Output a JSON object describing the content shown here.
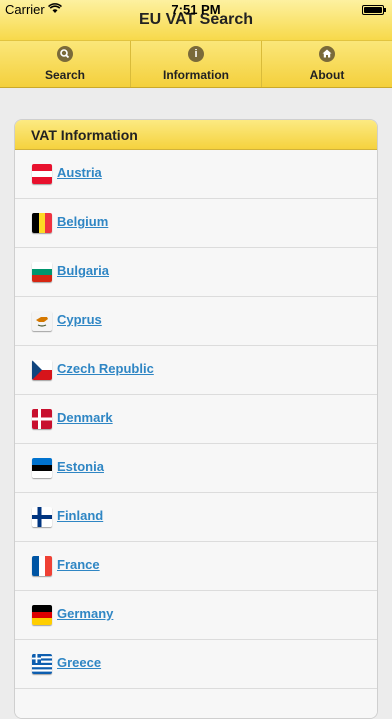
{
  "statusbar": {
    "carrier": "Carrier",
    "time": "7:51 PM"
  },
  "app": {
    "title": "EU VAT Search"
  },
  "nav": [
    {
      "label": "Search",
      "icon": "search-icon"
    },
    {
      "label": "Information",
      "icon": "info-icon"
    },
    {
      "label": "About",
      "icon": "home-icon"
    }
  ],
  "panel": {
    "title": "VAT Information"
  },
  "countries": [
    {
      "name": "Austria",
      "flag": "austria-flag-icon"
    },
    {
      "name": "Belgium",
      "flag": "belgium-flag-icon"
    },
    {
      "name": "Bulgaria",
      "flag": "bulgaria-flag-icon"
    },
    {
      "name": "Cyprus",
      "flag": "cyprus-flag-icon"
    },
    {
      "name": "Czech Republic",
      "flag": "czech-flag-icon"
    },
    {
      "name": "Denmark",
      "flag": "denmark-flag-icon"
    },
    {
      "name": "Estonia",
      "flag": "estonia-flag-icon"
    },
    {
      "name": "Finland",
      "flag": "finland-flag-icon"
    },
    {
      "name": "France",
      "flag": "france-flag-icon"
    },
    {
      "name": "Germany",
      "flag": "germany-flag-icon"
    },
    {
      "name": "Greece",
      "flag": "greece-flag-icon"
    },
    {
      "name": "",
      "flag": ""
    }
  ],
  "colors": {
    "accent": "#f5d23e",
    "link": "#2f86c4"
  }
}
